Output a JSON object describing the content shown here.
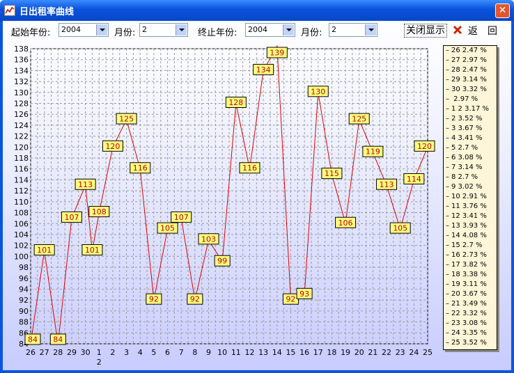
{
  "window": {
    "title": "日出租率曲线",
    "close_glyph": "✕"
  },
  "toolbar": {
    "start_year_label": "起始年份:",
    "start_year_value": "2004",
    "start_month_label": "月份:",
    "start_month_value": "2",
    "end_year_label": "终止年份:",
    "end_year_value": "2004",
    "end_month_label": "月份:",
    "end_month_value": "2",
    "toggle_display_label": "关闭显示",
    "back_label": "返",
    "return_label": "回"
  },
  "chart_data": {
    "type": "line",
    "title": "",
    "xlabel": "",
    "ylabel": "",
    "ylim": [
      84,
      138
    ],
    "ytick_step": 2,
    "grid": true,
    "x_categories": [
      "26",
      "27",
      "28",
      "29",
      "30",
      "1",
      "2",
      "3",
      "4",
      "5",
      "6",
      "7",
      "8",
      "9",
      "10",
      "11",
      "12",
      "13",
      "14",
      "15",
      "16",
      "17",
      "18",
      "19",
      "20",
      "21",
      "22",
      "23",
      "24",
      "25"
    ],
    "x_sublabel": {
      "under": "1",
      "text": "2"
    },
    "series": [
      {
        "values": [
          84,
          101,
          84,
          107,
          113,
          101,
          108,
          120,
          125,
          116,
          92,
          105,
          107,
          92,
          103,
          99,
          128,
          116,
          134,
          139,
          92,
          93,
          130,
          115,
          106,
          125,
          119,
          113,
          105,
          114,
          120
        ]
      }
    ],
    "points": [
      {
        "x": "26",
        "y": 84
      },
      {
        "x": "27",
        "y": 101
      },
      {
        "x": "28",
        "y": 84
      },
      {
        "x": "29",
        "y": 107
      },
      {
        "x": "30",
        "y": 113
      },
      {
        "x": "30.5",
        "y": 101
      },
      {
        "x": "1",
        "y": 108
      },
      {
        "x": "2",
        "y": 120
      },
      {
        "x": "3",
        "y": 125
      },
      {
        "x": "4",
        "y": 116
      },
      {
        "x": "5",
        "y": 92
      },
      {
        "x": "6",
        "y": 105
      },
      {
        "x": "7",
        "y": 107
      },
      {
        "x": "8",
        "y": 92
      },
      {
        "x": "9",
        "y": 103
      },
      {
        "x": "10",
        "y": 99
      },
      {
        "x": "11",
        "y": 128
      },
      {
        "x": "12",
        "y": 116
      },
      {
        "x": "13",
        "y": 134
      },
      {
        "x": "14",
        "y": 139
      },
      {
        "x": "15",
        "y": 92
      },
      {
        "x": "16",
        "y": 93
      },
      {
        "x": "17",
        "y": 130
      },
      {
        "x": "18",
        "y": 115
      },
      {
        "x": "19",
        "y": 106
      },
      {
        "x": "20",
        "y": 125
      },
      {
        "x": "21",
        "y": 119
      },
      {
        "x": "22",
        "y": 113
      },
      {
        "x": "23",
        "y": 105
      },
      {
        "x": "24",
        "y": 114
      },
      {
        "x": "25",
        "y": 120
      }
    ],
    "line_color": "#e00000",
    "label_bg": "#ffff80"
  },
  "side_panel": {
    "rows": [
      "26  2.47 %",
      "27  2.97 %",
      "28  2.47 %",
      "29  3.14 %",
      "30  3.32 %",
      "   2.97 %",
      "1 2  3.17 %",
      "2  3.52 %",
      "3  3.67 %",
      "4  3.41 %",
      "5  2.7 %",
      "6  3.08 %",
      "7  3.14 %",
      "8  2.7 %",
      "9  3.02 %",
      "10  2.91 %",
      "11  3.76 %",
      "12  3.41 %",
      "13  3.93 %",
      "14  4.08 %",
      "15  2.7 %",
      "16  2.73 %",
      "17  3.82 %",
      "18  3.38 %",
      "19  3.11 %",
      "20  3.67 %",
      "21  3.49 %",
      "22  3.32 %",
      "23  3.08 %",
      "24  3.35 %",
      "25  3.52 %"
    ]
  }
}
